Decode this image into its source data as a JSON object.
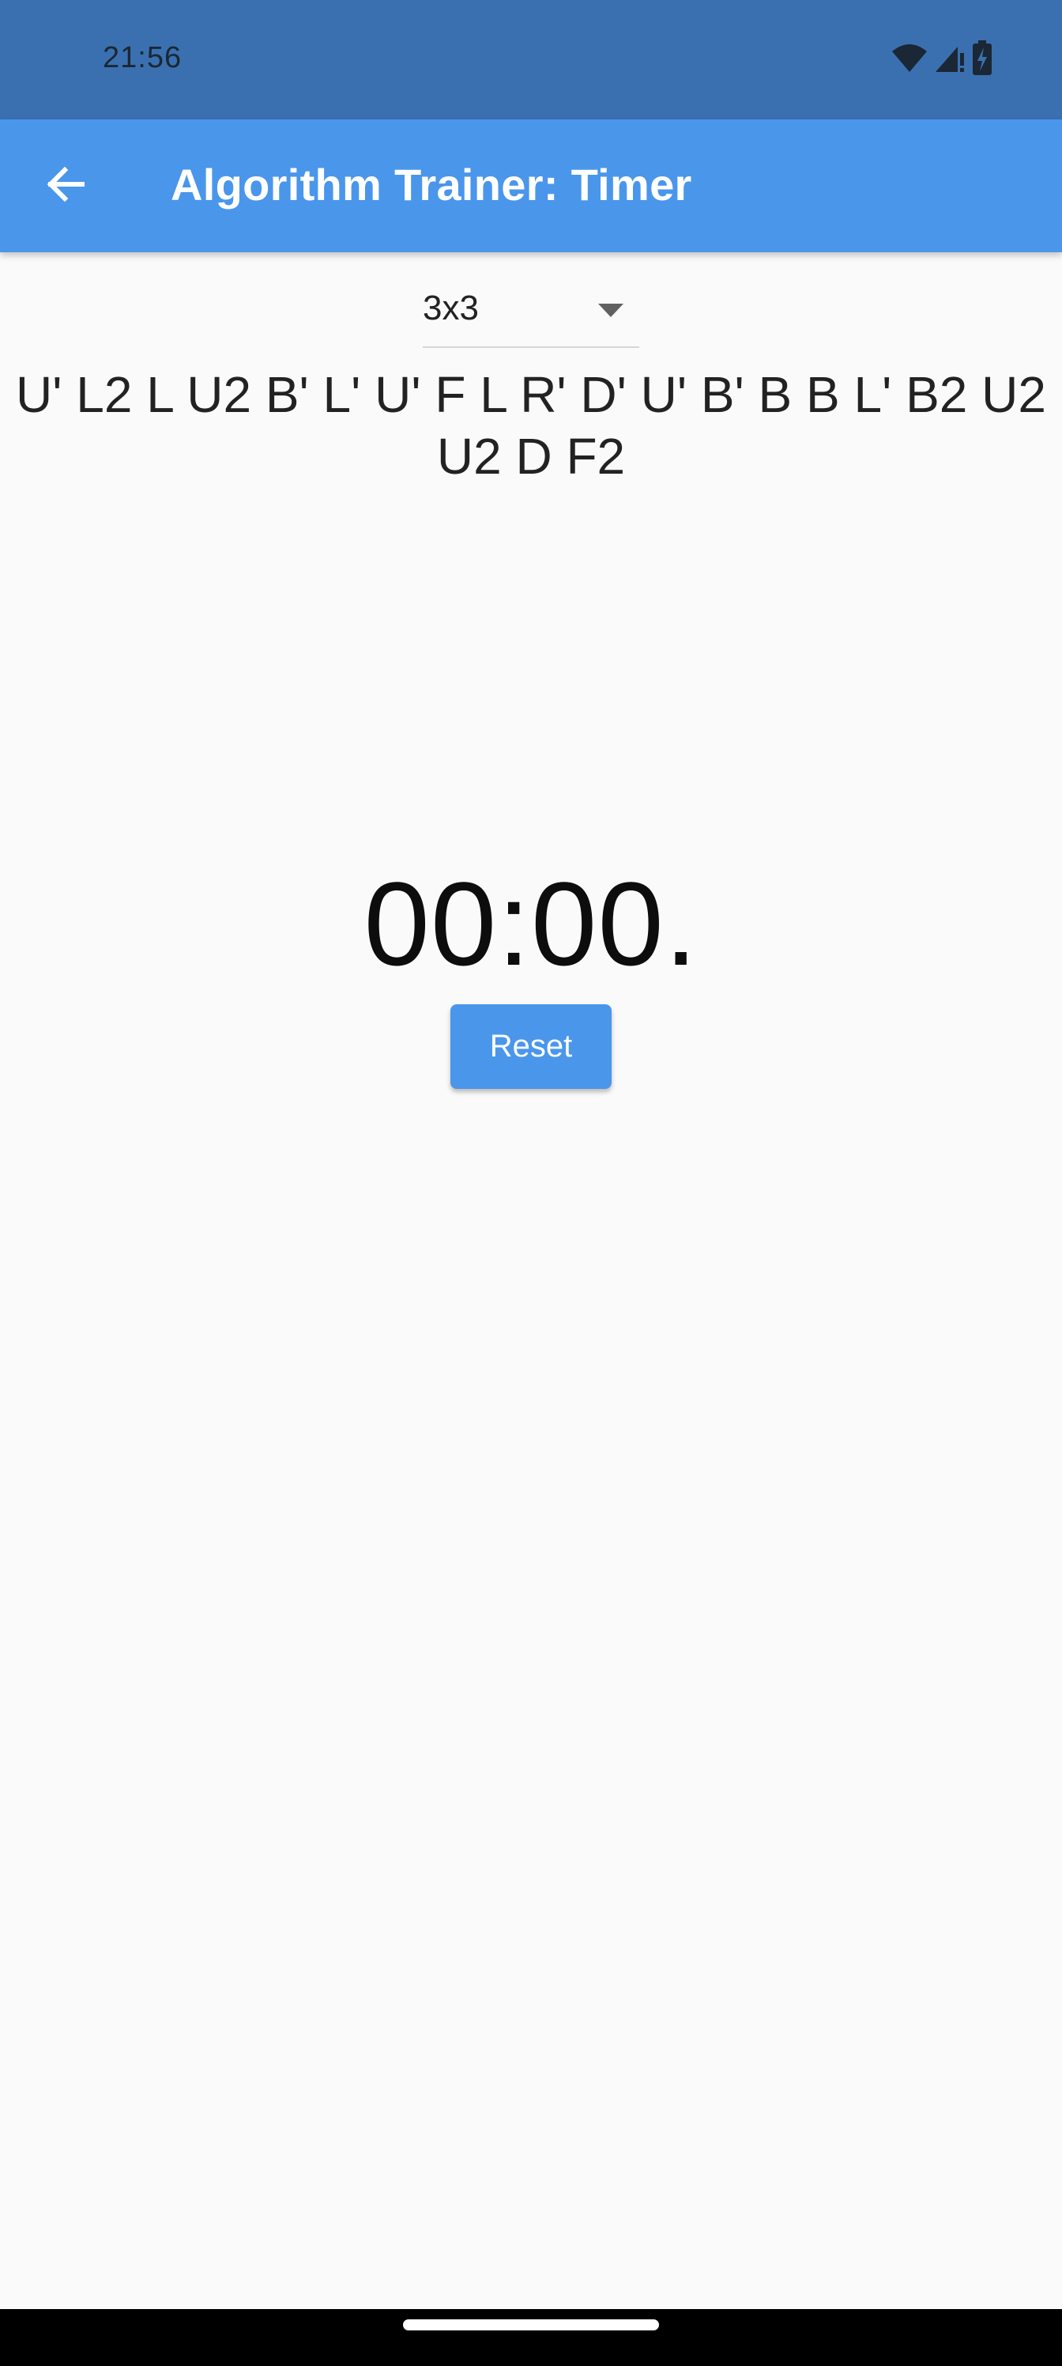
{
  "status_bar": {
    "time": "21:56",
    "icons": [
      "wifi-icon",
      "signal-icon",
      "battery-charging-icon"
    ]
  },
  "app_bar": {
    "title": "Algorithm Trainer: Timer",
    "back_icon": "arrow-back-icon"
  },
  "puzzle_select": {
    "value": "3x3"
  },
  "scramble": {
    "text": "U' L2 L U2 B' L' U' F L R' D' U' B' B B L' B2 U2 U2 D F2"
  },
  "timer": {
    "display": "00:00."
  },
  "buttons": {
    "reset_label": "Reset"
  },
  "colors": {
    "status_bar": "#3a70b0",
    "app_bar": "#4a96eb",
    "background": "#fafafa",
    "button": "#4a96eb"
  }
}
